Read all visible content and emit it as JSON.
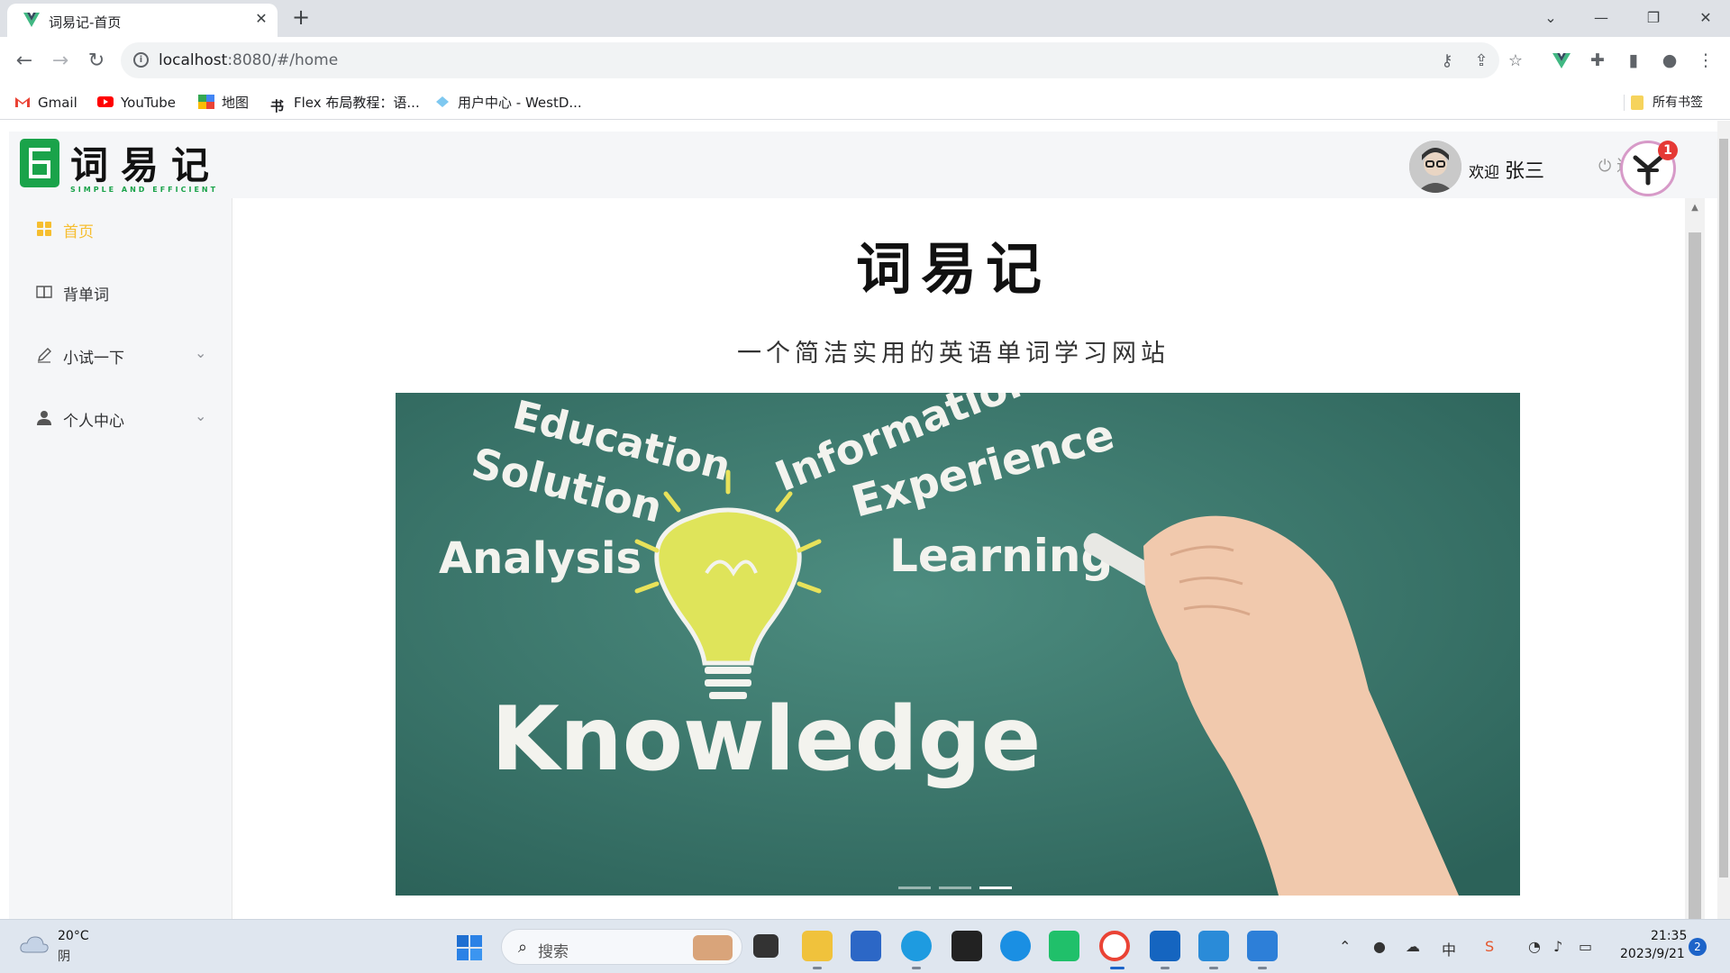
{
  "browser": {
    "tab_title": "词易记-首页",
    "tab_close": "✕",
    "new_tab": "+",
    "url_host": "localhost",
    "url_rest": ":8080/#/home",
    "window_controls": {
      "chevron": "⌄",
      "minimize": "—",
      "restore": "❐",
      "close": "✕"
    }
  },
  "bookmarks": [
    {
      "label": "Gmail",
      "icon": "gmail-icon"
    },
    {
      "label": "YouTube",
      "icon": "youtube-icon"
    },
    {
      "label": "地图",
      "icon": "maps-icon"
    },
    {
      "label": "Flex 布局教程：语...",
      "icon": "blog-icon"
    },
    {
      "label": "用户中心 - WestD...",
      "icon": "westd-icon"
    }
  ],
  "bookmarks_all": "所有书签",
  "app": {
    "logo_text": "词易记",
    "logo_sub": "SIMPLE AND EFFICIENT",
    "welcome": "欢迎",
    "user_name": "张三",
    "logout": "退出",
    "notification_count": "1"
  },
  "sidebar": {
    "items": [
      {
        "label": "首页",
        "active": true,
        "icon": "grid-icon",
        "expandable": false
      },
      {
        "label": "背单词",
        "active": false,
        "icon": "book-icon",
        "expandable": false
      },
      {
        "label": "小试一下",
        "active": false,
        "icon": "pen-icon",
        "expandable": true
      },
      {
        "label": "个人中心",
        "active": false,
        "icon": "user-icon",
        "expandable": true
      }
    ]
  },
  "main": {
    "title": "词易记",
    "subtitle": "一个简洁实用的英语单词学习网站",
    "carousel": {
      "words": [
        "Education",
        "Information",
        "Solution",
        "Experience",
        "Analysis",
        "Learning",
        "Knowledge"
      ],
      "slide_count": 3,
      "active_slide": 3
    }
  },
  "taskbar": {
    "weather_temp": "20°C",
    "weather_desc": "阴",
    "search_label": "搜索",
    "time": "21:35",
    "date": "2023/9/21",
    "notification_count": "2"
  },
  "colors": {
    "accent_active": "#f6be2f",
    "logo_green": "#1aa34a",
    "chalkboard": "#3d7a6f"
  }
}
